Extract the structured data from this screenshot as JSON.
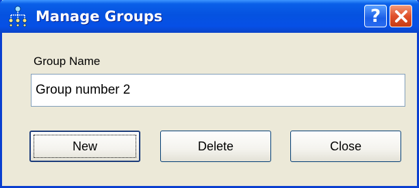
{
  "window": {
    "title": "Manage Groups",
    "icon": "groups-tree-icon",
    "help_glyph": "?",
    "close_icon": "close-icon"
  },
  "form": {
    "group_name_label": "Group Name",
    "group_name_value": "Group number 2"
  },
  "buttons": {
    "new_label": "New",
    "delete_label": "Delete",
    "close_label": "Close"
  },
  "colors": {
    "titlebar": "#0552e0",
    "window_bg": "#ece9d8",
    "close_button": "#e0502a"
  }
}
